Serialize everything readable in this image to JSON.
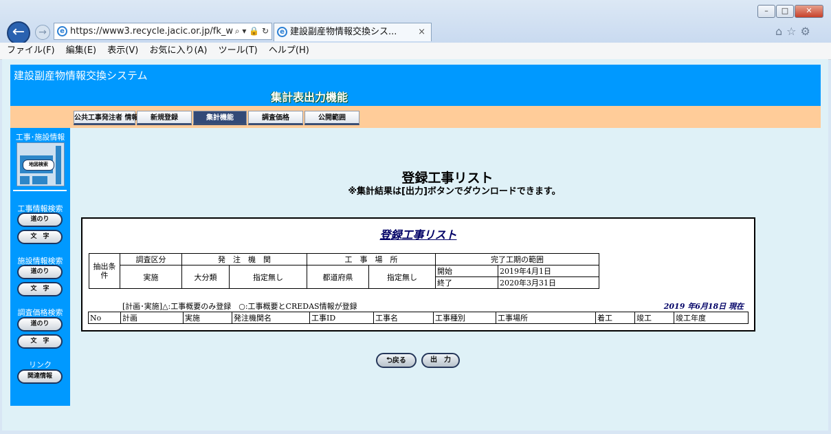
{
  "browser": {
    "url": "https://www3.recycle.jacic.or.jp/fk_w",
    "tab_title": "建設副産物情報交換シス...",
    "tab_close": "×",
    "win_min": "–",
    "win_max": "□",
    "win_close": "✕",
    "right_icons": [
      "⌂",
      "☆",
      "⚙"
    ],
    "menu": [
      "ファイル(F)",
      "編集(E)",
      "表示(V)",
      "お気に入り(A)",
      "ツール(T)",
      "ヘルプ(H)"
    ]
  },
  "header": {
    "system_title": "建設副産物情報交換システム",
    "function_title": "集計表出力機能"
  },
  "nav_tabs": [
    "公共工事発注者 情報",
    "新規登録",
    "集計機能",
    "調査価格",
    "公開範囲"
  ],
  "active_tab": "集計機能",
  "sidebar": {
    "section1": "工事･施設情報",
    "map_button": "地図検索",
    "section2": "工事情報検索",
    "section3": "施設情報検索",
    "section4": "調査価格検索",
    "route_btn": "道のり",
    "text_btn": "文　字",
    "link_label": "リンク",
    "link_btn": "関連情報"
  },
  "main": {
    "title": "登録工事リスト",
    "note": "※集計結果は[出力]ボタンでダウンロードできます。",
    "box_title": "登録工事リスト",
    "cond": {
      "label": "抽出条件",
      "h_survey": "調査区分",
      "h_org": "発　注　機　関",
      "h_site": "工　事　場　所",
      "h_period": "完了工期の範囲",
      "v_survey": "実施",
      "v_org_type": "大分類",
      "v_org": "指定無し",
      "v_pref": "都道府県",
      "v_site": "指定無し",
      "start_label": "開始",
      "start": "2019年4月1日",
      "end_label": "終了",
      "end": "2020年3月31日"
    },
    "legend": "[計画･実施]△:工事概要のみ登録　○:工事概要とCREDAS情報が登録",
    "as_of": "2019 年6月18日  現在",
    "columns": [
      "No",
      "計画",
      "実施",
      "発注機関名",
      "工事ID",
      "工事名",
      "工事種別",
      "工事場所",
      "着工",
      "竣工",
      "竣工年度"
    ],
    "back_btn": "戻る",
    "output_btn": "出　力"
  }
}
